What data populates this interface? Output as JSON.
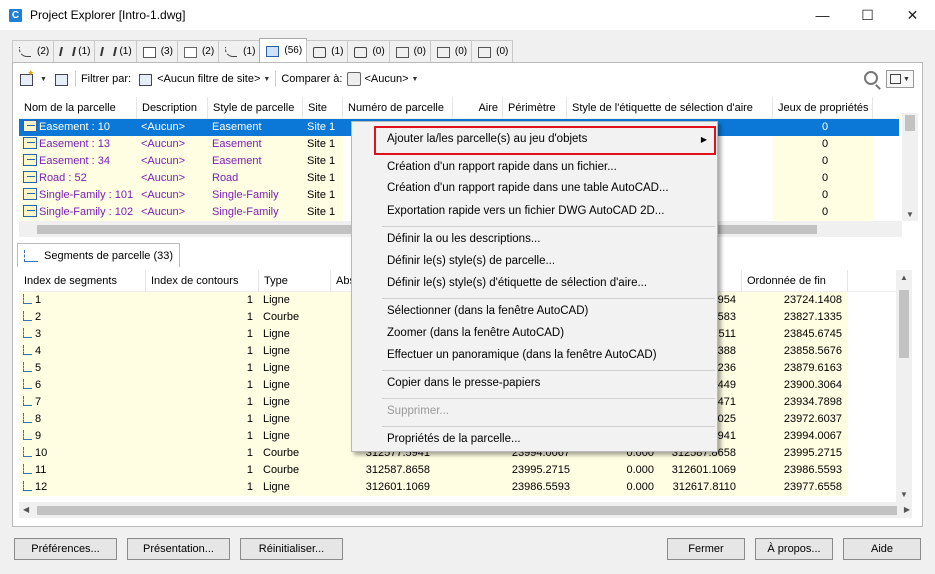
{
  "window": {
    "title": "Project Explorer [Intro-1.dwg]",
    "app_icon_letter": "C"
  },
  "tabs": [
    {
      "icon": "alignment-icon",
      "count": "(2)"
    },
    {
      "icon": "road-icon",
      "count": "(1)"
    },
    {
      "icon": "corridor-icon",
      "count": "(1)"
    },
    {
      "icon": "surface-icon",
      "count": "(3)"
    },
    {
      "icon": "site-icon",
      "count": "(2)"
    },
    {
      "icon": "profile-icon",
      "count": "(1)"
    },
    {
      "icon": "parcel-icon",
      "count": "(56)"
    },
    {
      "icon": "pipe-network-icon",
      "count": "(1)"
    },
    {
      "icon": "pressure-network-icon",
      "count": "(0)"
    },
    {
      "icon": "sample-lines-icon",
      "count": "(0)"
    },
    {
      "icon": "feature-line-icon",
      "count": "(0)"
    },
    {
      "icon": "assembly-icon",
      "count": "(0)"
    }
  ],
  "toolbar": {
    "filter_label": "Filtrer par:",
    "filter_value": "<Aucun filtre de site>",
    "compare_label": "Comparer à:",
    "compare_value": "<Aucun>"
  },
  "parcels": {
    "columns": [
      "Nom de la parcelle",
      "Description",
      "Style de parcelle",
      "Site",
      "Numéro de parcelle",
      "Aire",
      "Périmètre",
      "Style de l'étiquette de sélection d'aire",
      "Jeux de propriétés"
    ],
    "rows": [
      {
        "name": "Easement : 10",
        "desc": "<Aucun>",
        "style": "Easement",
        "site": "Site 1",
        "props": "0",
        "selected": true
      },
      {
        "name": "Easement : 13",
        "desc": "<Aucun>",
        "style": "Easement",
        "site": "Site 1",
        "props": "0"
      },
      {
        "name": "Easement : 34",
        "desc": "<Aucun>",
        "style": "Easement",
        "site": "Site 1",
        "props": "0"
      },
      {
        "name": "Road : 52",
        "desc": "<Aucun>",
        "style": "Road",
        "site": "Site 1",
        "props": "0"
      },
      {
        "name": "Single-Family : 101",
        "desc": "<Aucun>",
        "style": "Single-Family",
        "site": "Site 1",
        "props": "0"
      },
      {
        "name": "Single-Family : 102",
        "desc": "<Aucun>",
        "style": "Single-Family",
        "site": "Site 1",
        "props": "0"
      }
    ]
  },
  "segments": {
    "tab_label": "Segments de parcelle (33)",
    "columns": [
      "Index de segments",
      "Index de contours",
      "Type",
      "Abs",
      "",
      "",
      "isse de fin",
      "Ordonnée de fin"
    ],
    "rows": [
      {
        "i": "1",
        "c": "1",
        "t": "Ligne",
        "a": "",
        "b": "",
        "d": "",
        "e": "2432.0954",
        "f": "23724.1408"
      },
      {
        "i": "2",
        "c": "1",
        "t": "Courbe",
        "a": "",
        "b": "",
        "d": "",
        "e": "2506.4583",
        "f": "23827.1335"
      },
      {
        "i": "3",
        "c": "1",
        "t": "Ligne",
        "a": "",
        "b": "",
        "d": "",
        "e": "2552.1511",
        "f": "23845.6745"
      },
      {
        "i": "4",
        "c": "1",
        "t": "Ligne",
        "a": "",
        "b": "",
        "d": "",
        "e": "2583.3388",
        "f": "23858.5676"
      },
      {
        "i": "5",
        "c": "1",
        "t": "Ligne",
        "a": "",
        "b": "",
        "d": "",
        "e": "2603.2236",
        "f": "23879.6163"
      },
      {
        "i": "6",
        "c": "1",
        "t": "Ligne",
        "a": "",
        "b": "",
        "d": "",
        "e": "2612.9449",
        "f": "23900.3064"
      },
      {
        "i": "7",
        "c": "1",
        "t": "Ligne",
        "a": "",
        "b": "",
        "d": "",
        "e": "2629.1471",
        "f": "23934.7898"
      },
      {
        "i": "8",
        "c": "1",
        "t": "Ligne",
        "a": "",
        "b": "",
        "d": "",
        "e": "2599.5025",
        "f": "23972.6037"
      },
      {
        "i": "9",
        "c": "1",
        "t": "Ligne",
        "a": "",
        "b": "",
        "d": "",
        "e": "2577.5941",
        "f": "23994.0067"
      },
      {
        "i": "10",
        "c": "1",
        "t": "Courbe",
        "a": "312577.5941",
        "b": "23994.0067",
        "d": "0.000",
        "e": "312587.8658",
        "f": "23995.2715"
      },
      {
        "i": "11",
        "c": "1",
        "t": "Courbe",
        "a": "312587.8658",
        "b": "23995.2715",
        "d": "0.000",
        "e": "312601.1069",
        "f": "23986.5593"
      },
      {
        "i": "12",
        "c": "1",
        "t": "Ligne",
        "a": "312601.1069",
        "b": "23986.5593",
        "d": "0.000",
        "e": "312617.8110",
        "f": "23977.6558"
      }
    ]
  },
  "context_menu": {
    "items": [
      "Ajouter la/les parcelle(s) au jeu d'objets",
      "Création d'un rapport rapide dans un fichier...",
      "Création d'un rapport rapide dans une table AutoCAD...",
      "Exportation rapide vers un fichier DWG AutoCAD 2D...",
      "Définir la ou les descriptions...",
      "Définir le(s) style(s) de parcelle...",
      "Définir le(s) style(s) d'étiquette de sélection d'aire...",
      "Sélectionner (dans la fenêtre AutoCAD)",
      "Zoomer (dans la fenêtre AutoCAD)",
      "Effectuer un panoramique (dans la fenêtre AutoCAD)",
      "Copier dans le presse-papiers",
      "Supprimer...",
      "Propriétés de la parcelle..."
    ],
    "highlight_color": "#e0101c"
  },
  "buttons": {
    "preferences": "Préférences...",
    "presentation": "Présentation...",
    "reset": "Réinitialiser...",
    "close": "Fermer",
    "about": "À propos...",
    "help": "Aide"
  },
  "colors": {
    "selection": "#0b78d7",
    "purple_text": "#7a1fb8",
    "row_tint": "#fffde2"
  }
}
